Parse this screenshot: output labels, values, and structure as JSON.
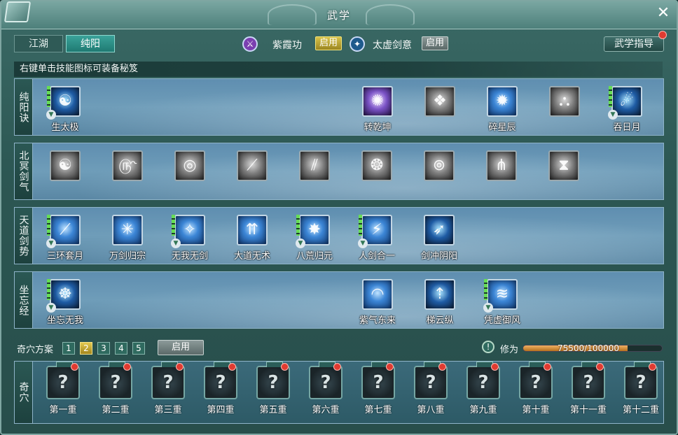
{
  "window": {
    "title": "武学"
  },
  "tabs": [
    {
      "label": "江湖"
    },
    {
      "label": "纯阳"
    }
  ],
  "arts": [
    {
      "label": "紫霞功",
      "status": "启用"
    },
    {
      "label": "太虚剑意",
      "status": "启用"
    }
  ],
  "guide_button": "武学指导",
  "hint": "右键单击技能图标可装备秘笈",
  "rows": [
    {
      "label": "纯阳诀",
      "skills": [
        "生太极",
        "转乾坤",
        "",
        "碎星辰",
        "",
        "吞日月"
      ]
    },
    {
      "label": "北冥剑气",
      "skills": [
        "",
        "",
        "",
        "",
        "",
        "",
        "",
        "",
        ""
      ]
    },
    {
      "label": "天道剑势",
      "skills": [
        "三环套月",
        "万剑归宗",
        "无我无剑",
        "大道无术",
        "八荒归元",
        "人剑合一",
        "剑冲阴阳"
      ]
    },
    {
      "label": "坐忘经",
      "skills": [
        "坐忘无我",
        "紫气东来",
        "梯云纵",
        "凭虚御风"
      ]
    }
  ],
  "scheme": {
    "label": "奇穴方案",
    "numbers": [
      "1",
      "2",
      "3",
      "4",
      "5"
    ],
    "active": 2,
    "enable_label": "启用"
  },
  "xiuwei": {
    "label": "修为",
    "text": "75500/100000",
    "progress": 0.755
  },
  "qixue": {
    "label": "奇穴",
    "slots": [
      "第一重",
      "第二重",
      "第三重",
      "第四重",
      "第五重",
      "第六重",
      "第七重",
      "第八重",
      "第九重",
      "第十重",
      "第十一重",
      "第十二重"
    ]
  },
  "colors": {
    "accent": "#1f7a72",
    "enable_gold": "#d8c34a",
    "progress": "#f0b064",
    "notify": "#e03b31"
  },
  "icons": [
    "book-icon",
    "close-icon",
    "purple-art-icon",
    "sword-art-icon",
    "question-icon",
    "info-icon"
  ]
}
